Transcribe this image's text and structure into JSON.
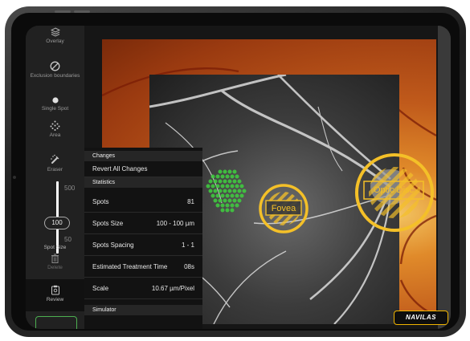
{
  "sidebar": {
    "tools": [
      {
        "icon": "overlay-icon",
        "label": "Overlay"
      },
      {
        "icon": "exclusion-boundaries-icon",
        "label": "Exclusion boundaries"
      },
      {
        "icon": "single-spot-icon",
        "label": "Single Spot"
      },
      {
        "icon": "area-icon",
        "label": "Area"
      },
      {
        "icon": "eraser-icon",
        "label": "Eraser"
      }
    ],
    "spot_size": {
      "max": "500",
      "value": "100",
      "min": "50",
      "label": "Spot Size"
    },
    "delete_label": "Delete",
    "review_label": "Review"
  },
  "panel": {
    "changes_header": "Changes",
    "revert_label": "Revert All Changes",
    "statistics_header": "Statistics",
    "stats": [
      {
        "label": "Spots",
        "value": "81"
      },
      {
        "label": "Spots Size",
        "value": "100 - 100 µm"
      },
      {
        "label": "Spots Spacing",
        "value": "1 - 1"
      },
      {
        "label": "Estimated Treatment Time",
        "value": "08s"
      },
      {
        "label": "Scale",
        "value": "10.67 µm/Pixel"
      }
    ],
    "simulator_header": "Simulator"
  },
  "markers": {
    "fovea": "Fovea",
    "optic_disc": "Optic Disc"
  },
  "brand": {
    "logo": "NAVILAS"
  },
  "colors": {
    "marker": "#f4c028",
    "spots": "#4ccf4c",
    "accent": "#4caf50"
  }
}
